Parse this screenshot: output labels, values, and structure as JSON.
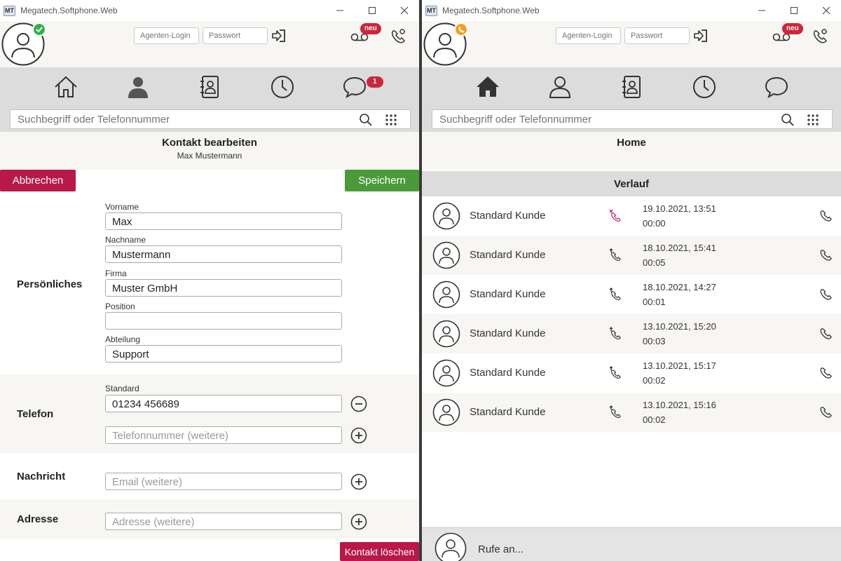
{
  "window_title": "Megatech.Softphone.Web",
  "logo_text": "MT",
  "header": {
    "agent_login_placeholder": "Agenten-Login",
    "password_placeholder": "Passwort",
    "new_badge": "neu"
  },
  "search": {
    "placeholder": "Suchbegriff oder Telefonnummer"
  },
  "left": {
    "messages_badge": "1",
    "title": "Kontakt bearbeiten",
    "subtitle": "Max Mustermann",
    "cancel_label": "Abbrechen",
    "save_label": "Speichern",
    "personal": {
      "label": "Persönliches",
      "fields": [
        {
          "label": "Vorname",
          "value": "Max"
        },
        {
          "label": "Nachname",
          "value": "Mustermann"
        },
        {
          "label": "Firma",
          "value": "Muster GmbH"
        },
        {
          "label": "Position",
          "value": ""
        },
        {
          "label": "Abteilung",
          "value": "Support"
        }
      ]
    },
    "phone": {
      "label": "Telefon",
      "standard_label": "Standard",
      "standard_value": "01234 456689",
      "more_placeholder": "Telefonnummer (weitere)"
    },
    "message": {
      "label": "Nachricht",
      "email_placeholder": "Email (weitere)"
    },
    "address": {
      "label": "Adresse",
      "address_placeholder": "Adresse (weitere)"
    },
    "delete_label": "Kontakt löschen"
  },
  "right": {
    "title": "Home",
    "history_label": "Verlauf",
    "history": [
      {
        "name": "Standard Kunde",
        "datetime": "19.10.2021, 13:51",
        "duration": "00:00",
        "direction": "missed"
      },
      {
        "name": "Standard Kunde",
        "datetime": "18.10.2021, 15:41",
        "duration": "00:05",
        "direction": "outgoing"
      },
      {
        "name": "Standard Kunde",
        "datetime": "18.10.2021, 14:27",
        "duration": "00:01",
        "direction": "outgoing"
      },
      {
        "name": "Standard Kunde",
        "datetime": "13.10.2021, 15:20",
        "duration": "00:03",
        "direction": "outgoing"
      },
      {
        "name": "Standard Kunde",
        "datetime": "13.10.2021, 15:17",
        "duration": "00:02",
        "direction": "outgoing"
      },
      {
        "name": "Standard Kunde",
        "datetime": "13.10.2021, 15:16",
        "duration": "00:02",
        "direction": "outgoing"
      }
    ],
    "calling_text": "Rufe an..."
  },
  "colors": {
    "accent_red": "#b8184a",
    "accent_green": "#4a9a3a",
    "status_green": "#2db34a",
    "status_orange": "#f0a020",
    "badge_red": "#d0243a"
  }
}
